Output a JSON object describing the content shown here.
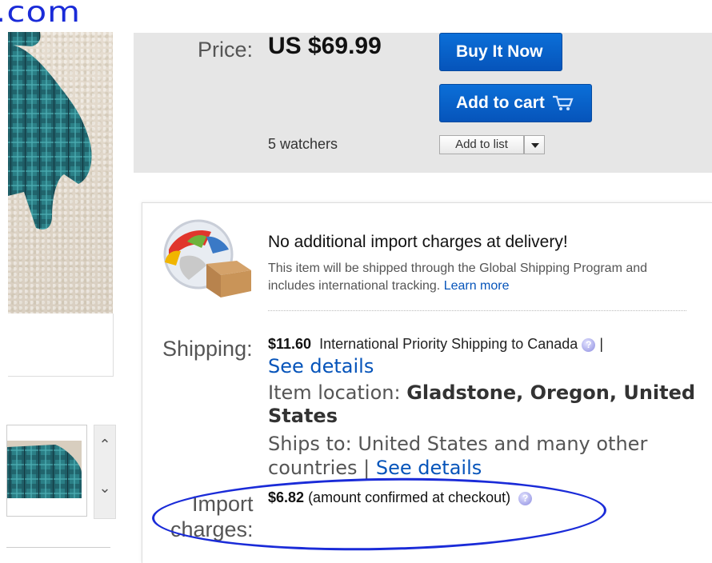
{
  "annotation": {
    "handwritten_text": ".com",
    "circle_color": "#1a2bd8"
  },
  "gallery": {
    "next_icon": "chevron-up",
    "prev_icon": "chevron-down",
    "up_glyph": "⌃",
    "down_glyph": "⌄"
  },
  "buy_box": {
    "price_label": "Price:",
    "price": "US $69.99",
    "buy_now_label": "Buy It Now",
    "add_to_cart_label": "Add to cart",
    "cart_icon": "shopping-cart",
    "watchers": "5 watchers",
    "add_to_list_label": "Add to list",
    "accent_color": "#0654ba"
  },
  "shipping": {
    "gsp_title": "No additional import charges at delivery!",
    "gsp_desc": "This item will be shipped through the Global Shipping Program and includes international tracking.",
    "learn_more": "Learn more",
    "shipping_label": "Shipping:",
    "shipping_price": "$11.60",
    "shipping_service": "International Priority Shipping to Canada",
    "separator": "|",
    "see_details": "See details",
    "item_location_label": "Item location:",
    "item_location": "Gladstone, Oregon, United States",
    "ships_to_label": "Ships to:",
    "ships_to": "United States and many other countries",
    "ships_to_sep": "|",
    "import_label_1": "Import",
    "import_label_2": "charges:",
    "import_amount": "$6.82",
    "import_note": "(amount confirmed at checkout)"
  }
}
